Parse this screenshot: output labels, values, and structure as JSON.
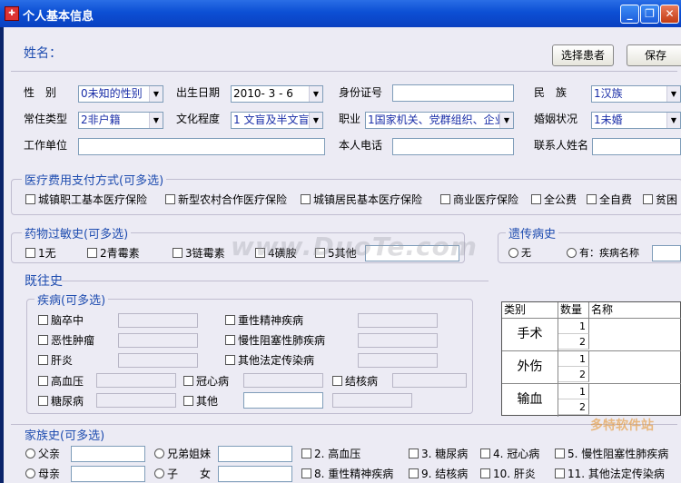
{
  "window": {
    "title": "个人基本信息",
    "buttons": [
      "_",
      "❐",
      "✕"
    ]
  },
  "header": {
    "name_label": "姓名：",
    "select_patient": "选择患者",
    "save": "保存"
  },
  "form": {
    "gender_label": "性　别",
    "gender_value": "0未知的性别",
    "birth_label": "出生日期",
    "birth_value": "2010- 3 - 6",
    "idcard_label": "身份证号",
    "nation_label": "民　族",
    "nation_value": "1汉族",
    "residence_label": "常住类型",
    "residence_value": "2非户籍",
    "education_label": "文化程度",
    "education_value": "1 文盲及半文盲",
    "job_label": "职业",
    "job_value": "1国家机关、党群组织、企业",
    "marital_label": "婚姻状况",
    "marital_value": "1未婚",
    "work_label": "工作单位",
    "phone_label": "本人电话",
    "contact_label": "联系人姓名"
  },
  "payment": {
    "title": "医疗费用支付方式(可多选)",
    "items": [
      "城镇职工基本医疗保险",
      "新型农村合作医疗保险",
      "城镇居民基本医疗保险",
      "商业医疗保险",
      "全公费",
      "全自费",
      "贫困"
    ]
  },
  "allergy": {
    "title": "药物过敏史(可多选)",
    "items": [
      "1无",
      "2青霉素",
      "3链霉素",
      "4磺胺",
      "5其他"
    ]
  },
  "heredity": {
    "title": "遗传病史",
    "none": "无",
    "has": "有：疾病名称"
  },
  "history": {
    "title": "既往史",
    "disease_title": "疾病(可多选)",
    "left": [
      "脑卒中",
      "恶性肿瘤",
      "肝炎"
    ],
    "right": [
      "重性精神疾病",
      "慢性阻塞性肺疾病",
      "其他法定传染病"
    ],
    "row4": [
      "高血压",
      "冠心病",
      "结核病"
    ],
    "row5": [
      "糖尿病",
      "其他"
    ]
  },
  "table": {
    "headers": [
      "类别",
      "数量",
      "名称"
    ],
    "rows": [
      {
        "cat": "手术",
        "nums": [
          "1",
          "2"
        ]
      },
      {
        "cat": "外伤",
        "nums": [
          "1",
          "2"
        ]
      },
      {
        "cat": "输血",
        "nums": [
          "1",
          "2"
        ]
      }
    ]
  },
  "family": {
    "title": "家族史(可多选)",
    "row1": [
      "父亲",
      "兄弟姐妹",
      "2. 高血压",
      "3. 糖尿病",
      "4. 冠心病",
      "5. 慢性阻塞性肺疾病"
    ],
    "row2": [
      "母亲",
      "子　　女",
      "8. 重性精神疾病",
      "9. 结核病",
      "10. 肝炎",
      "11. 其他法定传染病"
    ]
  },
  "watermark": {
    "main": "www.DuoTe.com",
    "corner": "多特软件站"
  }
}
